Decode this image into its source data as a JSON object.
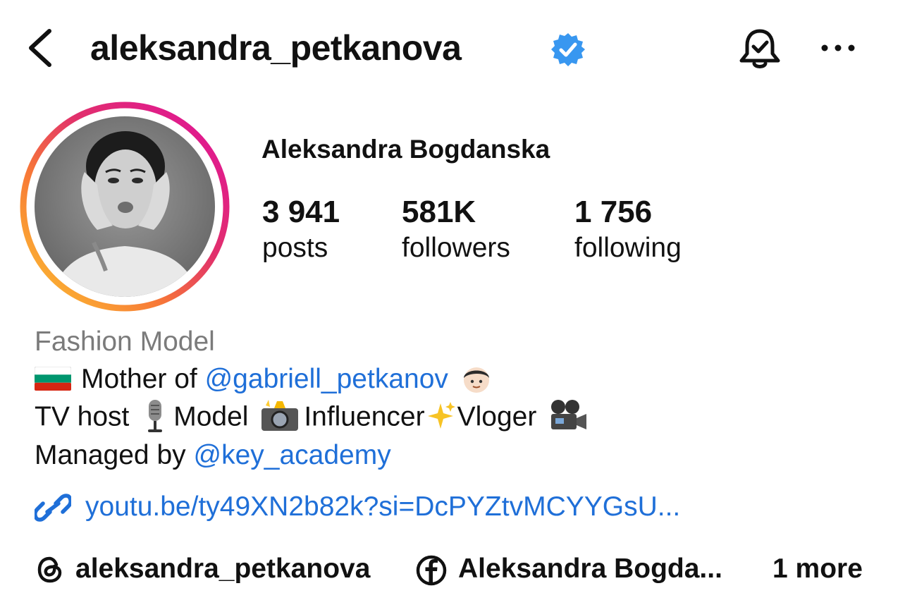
{
  "header": {
    "username": "aleksandra_petkanova",
    "verified": true
  },
  "profile": {
    "display_name": "Aleksandra Bogdanska",
    "stats": [
      {
        "value": "3 941",
        "label": "posts"
      },
      {
        "value": "581K",
        "label": "followers"
      },
      {
        "value": "1 756",
        "label": "following"
      }
    ]
  },
  "bio": {
    "category": "Fashion Model",
    "line1_prefix": "Mother of",
    "line1_mention": "@gabriell_petkanov",
    "line2_tv": "TV host",
    "line2_model": "Model",
    "line2_influencer": "Influencer",
    "line2_vloger": "Vloger",
    "line3_prefix": "Managed by",
    "line3_mention": "@key_academy",
    "link": "youtu.be/ty49XN2b82k?si=DcPYZtvMCYYGsU..."
  },
  "bottom_links": {
    "threads": "aleksandra_petkanova",
    "facebook": "Aleksandra Bogda...",
    "more": "1 more"
  },
  "icons": {
    "back": "chevron-left-icon",
    "verified": "verified-badge-icon",
    "notifications": "bell-check-icon",
    "more": "ellipsis-icon",
    "link": "link-icon",
    "threads": "threads-icon",
    "facebook": "facebook-icon"
  },
  "colors": {
    "link_blue": "#1f6fd8",
    "verified_blue": "#3897f0",
    "muted_gray": "#7b7b7b"
  }
}
